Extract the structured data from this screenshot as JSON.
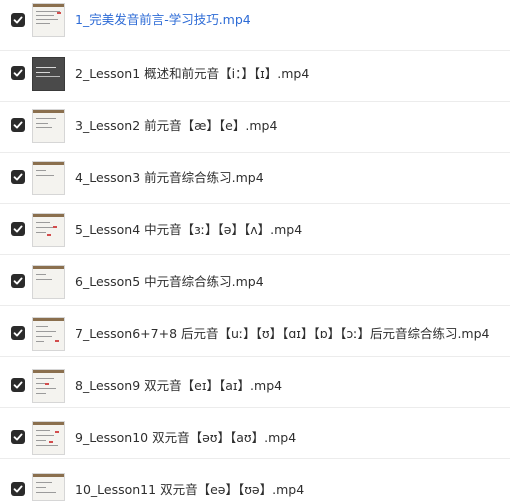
{
  "files": [
    {
      "name": "1_完美发音前言-学习技巧.mp4",
      "checked": true,
      "active": true,
      "thumb": "light"
    },
    {
      "name": "2_Lesson1 概述和前元音【i：】【ɪ】.mp4",
      "checked": true,
      "active": false,
      "thumb": "dark"
    },
    {
      "name": "3_Lesson2 前元音【æ】【e】.mp4",
      "checked": true,
      "active": false,
      "thumb": "light"
    },
    {
      "name": "4_Lesson3 前元音综合练习.mp4",
      "checked": true,
      "active": false,
      "thumb": "light"
    },
    {
      "name": "5_Lesson4 中元音【ɜː】【ə】【ʌ】.mp4",
      "checked": true,
      "active": false,
      "thumb": "light"
    },
    {
      "name": "6_Lesson5 中元音综合练习.mp4",
      "checked": true,
      "active": false,
      "thumb": "light"
    },
    {
      "name": "7_Lesson6+7+8 后元音【uː】【ʊ】【ɑɪ】【ɒ】【ɔː】后元音综合练习.mp4",
      "checked": true,
      "active": false,
      "thumb": "light"
    },
    {
      "name": "8_Lesson9 双元音【eɪ】【aɪ】.mp4",
      "checked": true,
      "active": false,
      "thumb": "light"
    },
    {
      "name": "9_Lesson10 双元音【əʊ】【aʊ】.mp4",
      "checked": true,
      "active": false,
      "thumb": "light"
    },
    {
      "name": "10_Lesson11 双元音【eə】【ʊə】.mp4",
      "checked": true,
      "active": false,
      "thumb": "light"
    }
  ],
  "colors": {
    "checkbox_fill": "#2b2b2b",
    "active_link": "#2d6bd6",
    "text": "#2e2e2e",
    "thumb_accent": "#8a6f4e"
  },
  "icons": {
    "checkbox": "checkmark-icon",
    "thumbnail": "video-thumbnail"
  }
}
